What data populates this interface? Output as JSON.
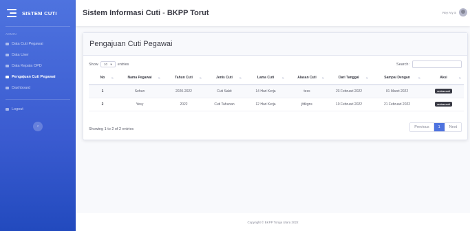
{
  "sidebar": {
    "brand": "SISTEM CUTI",
    "heading": "ADMIN",
    "items": [
      {
        "label": "Data Cuti Pegawai",
        "icon": "table-icon",
        "active": false
      },
      {
        "label": "Data User",
        "icon": "users-icon",
        "active": false
      },
      {
        "label": "Data Kepala OPD",
        "icon": "table-icon",
        "active": false
      },
      {
        "label": "Pengajuan Cuti Pegawai",
        "icon": "file-icon",
        "active": true
      },
      {
        "label": "Dashboard",
        "icon": "dashboard-icon",
        "active": false
      }
    ],
    "logout": "Logout",
    "toggle_glyph": "‹"
  },
  "topbar": {
    "title_main": "Sistem Informasi Cuti",
    "title_sep": " - ",
    "title_org": "BKPP Torut",
    "user_name": "Rey Ary S"
  },
  "card": {
    "title": "Pengajuan Cuti Pegawai",
    "show_label": "Show",
    "entries_value": "10",
    "entries_label": "entries",
    "search_label": "Search:",
    "info": "Showing 1 to 2 of 2 entries",
    "pagination": {
      "previous": "Previous",
      "current": "1",
      "next": "Next"
    }
  },
  "table": {
    "columns": [
      "No",
      "Nama Pegawai",
      "Tahun Cuti",
      "Jenis Cuti",
      "Lama Cuti",
      "Alasan Cuti",
      "Dari Tanggal",
      "Sampai Dengan",
      "Aksi"
    ],
    "rows": [
      [
        "1",
        "Sehun",
        "2020-2022",
        "Cuti Sakit",
        "14 Hari Kerja",
        "tess",
        "23 Februari 2022",
        "01 Maret 2022",
        "review cuti"
      ],
      [
        "2",
        "Yesy",
        "2022",
        "Cuti Tahunan",
        "12 Hari Kerja",
        "jfdkgns",
        "10 Februari 2022",
        "21 Februari 2022",
        "review cuti"
      ]
    ]
  },
  "footer": {
    "copyright": "Copyright © BKPP Toraja Utara 2022"
  }
}
